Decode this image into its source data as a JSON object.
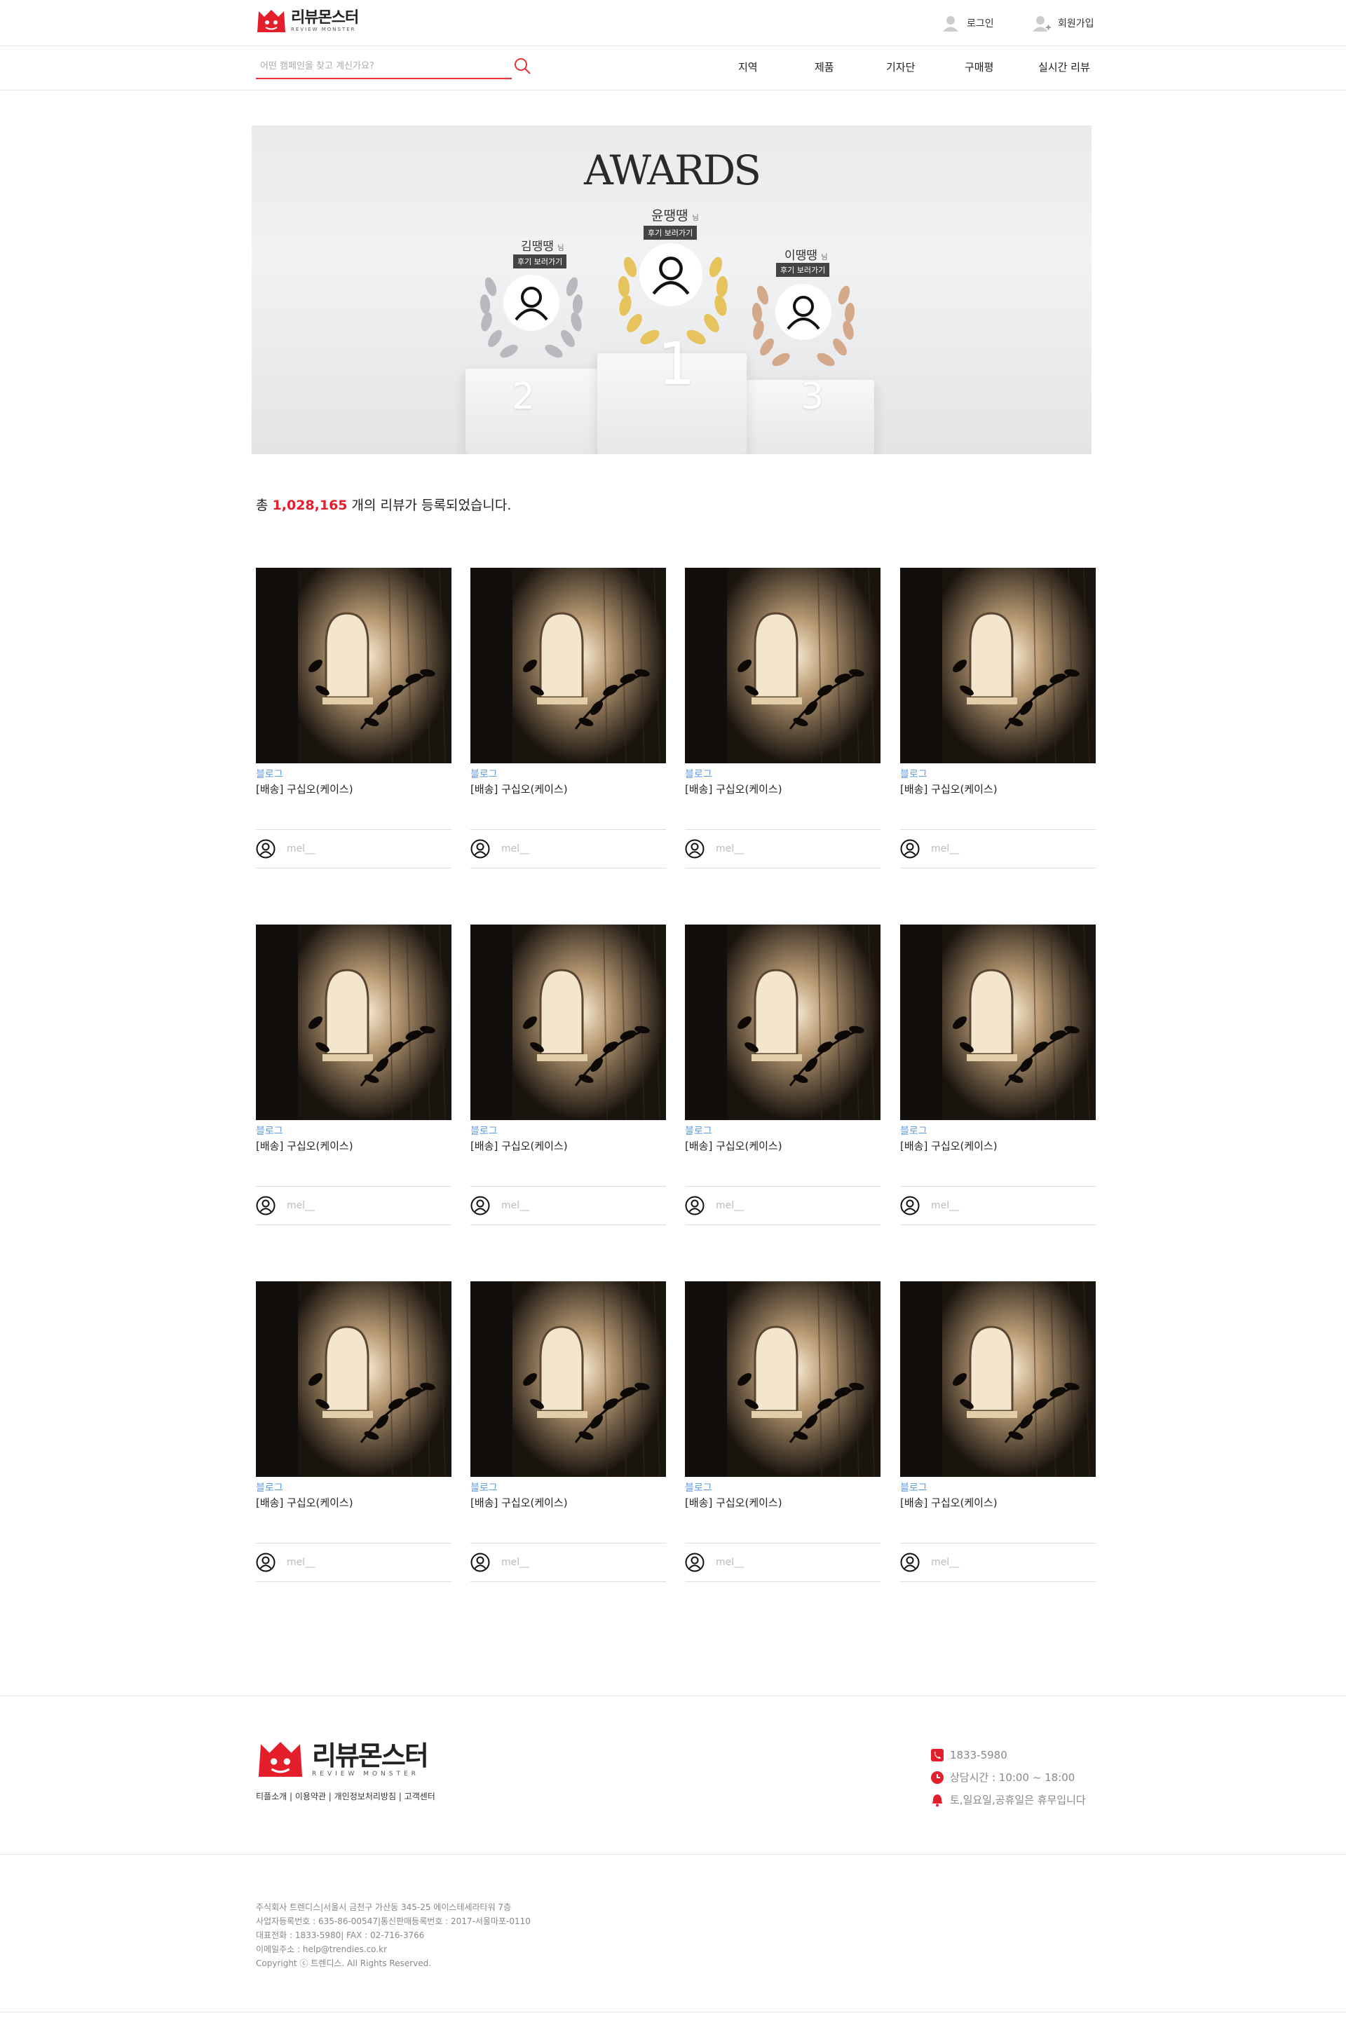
{
  "header": {
    "logo_ko": "리뷰몬스터",
    "logo_en": "REVIEW MONSTER",
    "login_label": "로그인",
    "join_label": "회원가입"
  },
  "nav": {
    "search_placeholder": "어떤 캠페인을 찾고 계신가요?",
    "menu": [
      "지역",
      "제품",
      "기자단",
      "구매평",
      "실시간 리뷰"
    ]
  },
  "banner": {
    "title": "AWARDS",
    "winners": [
      {
        "rank": "1",
        "name": "윤땡땡",
        "suffix": "님",
        "button": "후기 보러가기"
      },
      {
        "rank": "2",
        "name": "김땡땡",
        "suffix": "님",
        "button": "후기 보러가기"
      },
      {
        "rank": "3",
        "name": "이땡땡",
        "suffix": "님",
        "button": "후기 보러가기"
      }
    ]
  },
  "summary": {
    "prefix": "총 ",
    "count": "1,028,165",
    "suffix": " 개의 리뷰가 등록되었습니다."
  },
  "reviews": [
    {
      "type": "블로그",
      "title": "[배송] 구십오(케이스)",
      "user": "mel__"
    },
    {
      "type": "블로그",
      "title": "[배송] 구십오(케이스)",
      "user": "mel__"
    },
    {
      "type": "블로그",
      "title": "[배송] 구십오(케이스)",
      "user": "mel__"
    },
    {
      "type": "블로그",
      "title": "[배송] 구십오(케이스)",
      "user": "mel__"
    },
    {
      "type": "블로그",
      "title": "[배송] 구십오(케이스)",
      "user": "mel__"
    },
    {
      "type": "블로그",
      "title": "[배송] 구십오(케이스)",
      "user": "mel__"
    },
    {
      "type": "블로그",
      "title": "[배송] 구십오(케이스)",
      "user": "mel__"
    },
    {
      "type": "블로그",
      "title": "[배송] 구십오(케이스)",
      "user": "mel__"
    },
    {
      "type": "블로그",
      "title": "[배송] 구십오(케이스)",
      "user": "mel__"
    },
    {
      "type": "블로그",
      "title": "[배송] 구십오(케이스)",
      "user": "mel__"
    },
    {
      "type": "블로그",
      "title": "[배송] 구십오(케이스)",
      "user": "mel__"
    },
    {
      "type": "블로그",
      "title": "[배송] 구십오(케이스)",
      "user": "mel__"
    }
  ],
  "footer": {
    "logo_ko": "리뷰몬스터",
    "logo_en": "REVIEW MONSTER",
    "links": "티플소개 | 이용약관 | 개인정보처리방침 | 고객센터",
    "phone": "1833-5980",
    "hours": "상담시간 : 10:00 ~ 18:00",
    "holiday": "토,일요일,공휴일은 휴무입니다",
    "address_lines": [
      "주식회사 트렌디스|서울시 금천구 가산동 345-25 에이스테세라타워 7층",
      "사업자등록번호 : 635-86-00547|통신판매등록번호 : 2017-서울마포-0110",
      "대표전화 : 1833-5980| FAX : 02-716-3766",
      "이메일주소 : help@trendies.co.kr",
      "Copyright ⓒ 트렌디스. All Rights Reserved."
    ]
  },
  "colors": {
    "brand_red": "#e41e2b",
    "link_blue": "#5c9be0"
  }
}
